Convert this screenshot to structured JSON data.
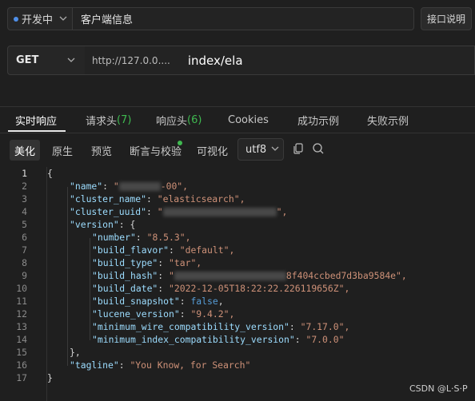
{
  "header": {
    "env_label": "开发中",
    "title": "客户端信息",
    "doc_button": "接口说明"
  },
  "request": {
    "method": "GET",
    "url_prefix": "http://127.0.0....",
    "url_path": "index/ela"
  },
  "response_tabs": [
    {
      "label": "实时响应",
      "count": ""
    },
    {
      "label": "请求头",
      "count": "(7)"
    },
    {
      "label": "响应头",
      "count": "(6)"
    },
    {
      "label": "Cookies",
      "count": ""
    },
    {
      "label": "成功示例",
      "count": ""
    },
    {
      "label": "失败示例",
      "count": ""
    }
  ],
  "view_modes": [
    "美化",
    "原生",
    "预览",
    "断言与校验",
    "可视化"
  ],
  "encoding": "utf8",
  "code": {
    "line_numbers": [
      "1",
      "2",
      "3",
      "4",
      "5",
      "6",
      "7",
      "8",
      "9",
      "10",
      "11",
      "12",
      "13",
      "14",
      "15",
      "16",
      "17"
    ],
    "l1": "{",
    "name_key": "\"name\"",
    "name_val_start": "\"",
    "name_val_end": "-00\",",
    "cluster_name_key": "\"cluster_name\"",
    "cluster_name_val": "\"elasticsearch\",",
    "cluster_uuid_key": "\"cluster_uuid\"",
    "cluster_uuid_val_start": "\"",
    "cluster_uuid_val_end": "\",",
    "version_key": "\"version\"",
    "version_open": "{",
    "number_key": "\"number\"",
    "number_val": "\"8.5.3\",",
    "build_flavor_key": "\"build_flavor\"",
    "build_flavor_val": "\"default\",",
    "build_type_key": "\"build_type\"",
    "build_type_val": "\"tar\",",
    "build_hash_key": "\"build_hash\"",
    "build_hash_val_start": "\"",
    "build_hash_val_end": "8f404ccbed7d3ba9584e\",",
    "build_date_key": "\"build_date\"",
    "build_date_val": "\"2022-12-05T18:22:22.226119656Z\",",
    "build_snapshot_key": "\"build_snapshot\"",
    "build_snapshot_val": "false",
    "lucene_key": "\"lucene_version\"",
    "lucene_val": "\"9.4.2\",",
    "min_wire_key": "\"minimum_wire_compatibility_version\"",
    "min_wire_val": "\"7.17.0\",",
    "min_index_key": "\"minimum_index_compatibility_version\"",
    "min_index_val": "\"7.0.0\"",
    "version_close": "},",
    "tagline_key": "\"tagline\"",
    "tagline_val": "\"You Know, for Search\"",
    "l17": "}"
  },
  "watermark": "CSDN @L·S·P"
}
